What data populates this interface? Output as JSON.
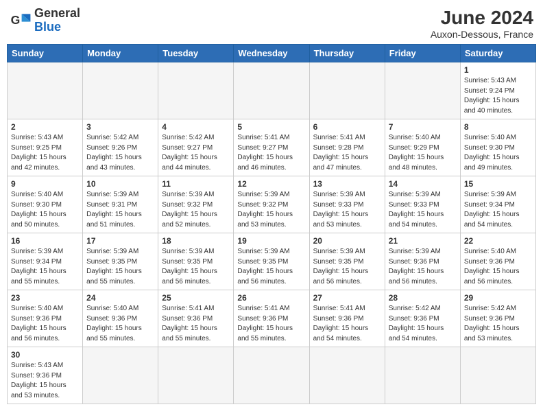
{
  "header": {
    "logo_general": "General",
    "logo_blue": "Blue",
    "month_title": "June 2024",
    "subtitle": "Auxon-Dessous, France"
  },
  "weekdays": [
    "Sunday",
    "Monday",
    "Tuesday",
    "Wednesday",
    "Thursday",
    "Friday",
    "Saturday"
  ],
  "weeks": [
    [
      {
        "day": "",
        "empty": true
      },
      {
        "day": "",
        "empty": true
      },
      {
        "day": "",
        "empty": true
      },
      {
        "day": "",
        "empty": true
      },
      {
        "day": "",
        "empty": true
      },
      {
        "day": "",
        "empty": true
      },
      {
        "day": "1",
        "sunrise": "5:43 AM",
        "sunset": "9:24 PM",
        "daylight": "15 hours and 40 minutes."
      }
    ],
    [
      {
        "day": "2",
        "sunrise": "5:43 AM",
        "sunset": "9:25 PM",
        "daylight": "15 hours and 42 minutes."
      },
      {
        "day": "3",
        "sunrise": "5:42 AM",
        "sunset": "9:26 PM",
        "daylight": "15 hours and 43 minutes."
      },
      {
        "day": "4",
        "sunrise": "5:42 AM",
        "sunset": "9:27 PM",
        "daylight": "15 hours and 44 minutes."
      },
      {
        "day": "5",
        "sunrise": "5:41 AM",
        "sunset": "9:27 PM",
        "daylight": "15 hours and 46 minutes."
      },
      {
        "day": "6",
        "sunrise": "5:41 AM",
        "sunset": "9:28 PM",
        "daylight": "15 hours and 47 minutes."
      },
      {
        "day": "7",
        "sunrise": "5:40 AM",
        "sunset": "9:29 PM",
        "daylight": "15 hours and 48 minutes."
      },
      {
        "day": "8",
        "sunrise": "5:40 AM",
        "sunset": "9:30 PM",
        "daylight": "15 hours and 49 minutes."
      }
    ],
    [
      {
        "day": "9",
        "sunrise": "5:40 AM",
        "sunset": "9:30 PM",
        "daylight": "15 hours and 50 minutes."
      },
      {
        "day": "10",
        "sunrise": "5:39 AM",
        "sunset": "9:31 PM",
        "daylight": "15 hours and 51 minutes."
      },
      {
        "day": "11",
        "sunrise": "5:39 AM",
        "sunset": "9:32 PM",
        "daylight": "15 hours and 52 minutes."
      },
      {
        "day": "12",
        "sunrise": "5:39 AM",
        "sunset": "9:32 PM",
        "daylight": "15 hours and 53 minutes."
      },
      {
        "day": "13",
        "sunrise": "5:39 AM",
        "sunset": "9:33 PM",
        "daylight": "15 hours and 53 minutes."
      },
      {
        "day": "14",
        "sunrise": "5:39 AM",
        "sunset": "9:33 PM",
        "daylight": "15 hours and 54 minutes."
      },
      {
        "day": "15",
        "sunrise": "5:39 AM",
        "sunset": "9:34 PM",
        "daylight": "15 hours and 54 minutes."
      }
    ],
    [
      {
        "day": "16",
        "sunrise": "5:39 AM",
        "sunset": "9:34 PM",
        "daylight": "15 hours and 55 minutes."
      },
      {
        "day": "17",
        "sunrise": "5:39 AM",
        "sunset": "9:35 PM",
        "daylight": "15 hours and 55 minutes."
      },
      {
        "day": "18",
        "sunrise": "5:39 AM",
        "sunset": "9:35 PM",
        "daylight": "15 hours and 56 minutes."
      },
      {
        "day": "19",
        "sunrise": "5:39 AM",
        "sunset": "9:35 PM",
        "daylight": "15 hours and 56 minutes."
      },
      {
        "day": "20",
        "sunrise": "5:39 AM",
        "sunset": "9:35 PM",
        "daylight": "15 hours and 56 minutes."
      },
      {
        "day": "21",
        "sunrise": "5:39 AM",
        "sunset": "9:36 PM",
        "daylight": "15 hours and 56 minutes."
      },
      {
        "day": "22",
        "sunrise": "5:40 AM",
        "sunset": "9:36 PM",
        "daylight": "15 hours and 56 minutes."
      }
    ],
    [
      {
        "day": "23",
        "sunrise": "5:40 AM",
        "sunset": "9:36 PM",
        "daylight": "15 hours and 56 minutes."
      },
      {
        "day": "24",
        "sunrise": "5:40 AM",
        "sunset": "9:36 PM",
        "daylight": "15 hours and 55 minutes."
      },
      {
        "day": "25",
        "sunrise": "5:41 AM",
        "sunset": "9:36 PM",
        "daylight": "15 hours and 55 minutes."
      },
      {
        "day": "26",
        "sunrise": "5:41 AM",
        "sunset": "9:36 PM",
        "daylight": "15 hours and 55 minutes."
      },
      {
        "day": "27",
        "sunrise": "5:41 AM",
        "sunset": "9:36 PM",
        "daylight": "15 hours and 54 minutes."
      },
      {
        "day": "28",
        "sunrise": "5:42 AM",
        "sunset": "9:36 PM",
        "daylight": "15 hours and 54 minutes."
      },
      {
        "day": "29",
        "sunrise": "5:42 AM",
        "sunset": "9:36 PM",
        "daylight": "15 hours and 53 minutes."
      }
    ],
    [
      {
        "day": "30",
        "sunrise": "5:43 AM",
        "sunset": "9:36 PM",
        "daylight": "15 hours and 53 minutes."
      },
      {
        "day": "",
        "empty": true
      },
      {
        "day": "",
        "empty": true
      },
      {
        "day": "",
        "empty": true
      },
      {
        "day": "",
        "empty": true
      },
      {
        "day": "",
        "empty": true
      },
      {
        "day": "",
        "empty": true
      }
    ]
  ],
  "labels": {
    "sunrise": "Sunrise:",
    "sunset": "Sunset:",
    "daylight": "Daylight:"
  }
}
